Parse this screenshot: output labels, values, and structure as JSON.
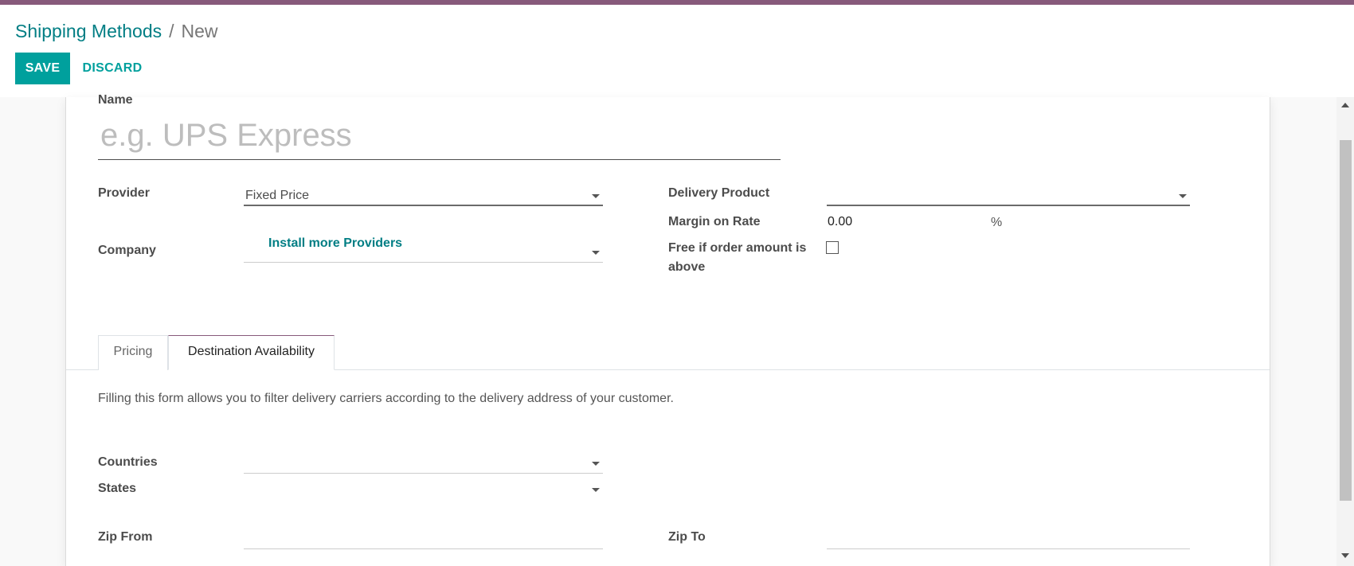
{
  "breadcrumb": {
    "parent": "Shipping Methods",
    "separator": "/",
    "current": "New"
  },
  "toolbar": {
    "save_label": "SAVE",
    "discard_label": "DISCARD"
  },
  "form": {
    "name_label": "Name",
    "name_placeholder": "e.g. UPS Express",
    "provider_label": "Provider",
    "provider_value": "Fixed Price",
    "install_link": "Install more Providers",
    "company_label": "Company",
    "company_value": "",
    "delivery_product_label": "Delivery Product",
    "delivery_product_value": "",
    "margin_label": "Margin on Rate",
    "margin_value": "0.00",
    "margin_unit": "%",
    "free_label_line1": "Free if order amount is",
    "free_label_line2": "above",
    "free_checked": false
  },
  "tabs": [
    {
      "label": "Pricing",
      "active": false
    },
    {
      "label": "Destination Availability",
      "active": true
    }
  ],
  "destination": {
    "help_text": "Filling this form allows you to filter delivery carriers according to the delivery address of your customer.",
    "countries_label": "Countries",
    "states_label": "States",
    "zip_from_label": "Zip From",
    "zip_to_label": "Zip To"
  },
  "colors": {
    "brand_bar": "#875a7b",
    "primary": "#00a09d",
    "link": "#017e84"
  }
}
